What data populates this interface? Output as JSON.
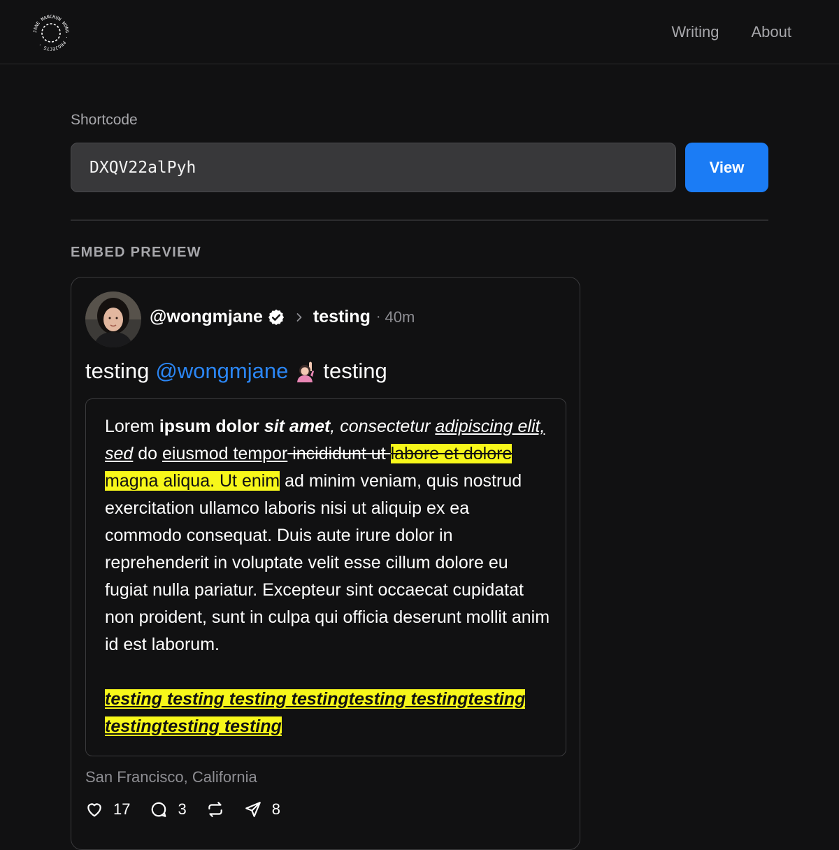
{
  "header": {
    "logo_text": "JANE MANCHUN WONG · PROJECTS ·",
    "nav": [
      {
        "label": "Writing"
      },
      {
        "label": "About"
      }
    ]
  },
  "form": {
    "label": "Shortcode",
    "value": "DXQV22alPyh",
    "button_label": "View"
  },
  "section_label": "EMBED PREVIEW",
  "post": {
    "username": "@wongmjane",
    "community": "testing",
    "separator": "·",
    "time": "40m",
    "text_before": "testing",
    "mention": "@wongmjane",
    "text_after": "testing",
    "quote": {
      "p1": {
        "a": "Lorem ",
        "b": "ipsum dolor ",
        "c": "sit amet",
        "d": ", consectetur ",
        "e": "adipiscing elit, sed",
        "f": " do ",
        "g": "eiusmod tempor",
        "h": " incididunt ut ",
        "i": "labore et dolore",
        "j": " magna aliqua. Ut enim",
        "k": " ad minim veniam, quis nostrud exercitation ullamco laboris nisi ut aliquip ex ea commodo consequat. Duis aute irure dolor in reprehenderit in voluptate velit esse cillum dolore eu fugiat nulla pariatur. Excepteur sint occaecat cupidatat non proident, sunt in culpa qui officia deserunt mollit anim id est laborum."
      },
      "p2": "testing testing testing testingtesting testingtesting testingtesting testing"
    },
    "location": "San Francisco, California",
    "actions": {
      "likes": "17",
      "comments": "3",
      "shares": "8"
    }
  },
  "colors": {
    "background": "#111112",
    "accent": "#1b7cf5",
    "highlight": "#f7f71a",
    "mention": "#2b86f5",
    "muted": "#8e8e93"
  }
}
